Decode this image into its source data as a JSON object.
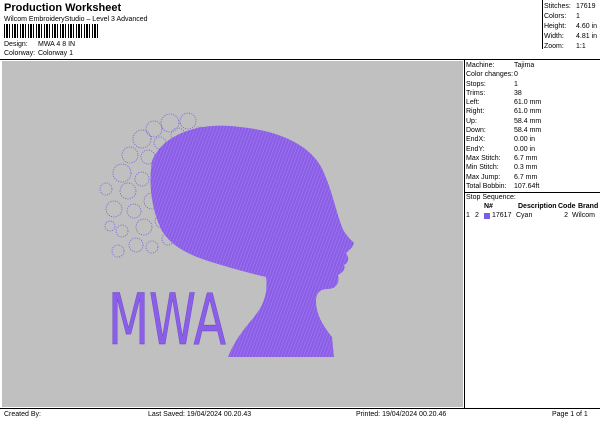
{
  "header": {
    "title": "Production Worksheet",
    "subtitle": "Wilcom EmbroideryStudio – Level 3 Advanced",
    "design_label": "Design:",
    "design_value": "MWA 4 8 IN",
    "colorway_label": "Colorway:",
    "colorway_value": "Colorway 1"
  },
  "summary": [
    {
      "k": "Stitches:",
      "v": "17619"
    },
    {
      "k": "Colors:",
      "v": "1"
    },
    {
      "k": "Height:",
      "v": "4.60 in"
    },
    {
      "k": "Width:",
      "v": "4.81 in"
    },
    {
      "k": "Zoom:",
      "v": "1:1"
    }
  ],
  "machine_info": [
    {
      "k": "Machine:",
      "v": "Tajima"
    },
    {
      "k": "Color changes:",
      "v": "0"
    },
    {
      "k": "Stops:",
      "v": "1"
    },
    {
      "k": "Trims:",
      "v": "38"
    },
    {
      "k": "Left:",
      "v": "61.0 mm"
    },
    {
      "k": "Right:",
      "v": "61.0 mm"
    },
    {
      "k": "Up:",
      "v": "58.4 mm"
    },
    {
      "k": "Down:",
      "v": "58.4 mm"
    },
    {
      "k": "EndX:",
      "v": "0.00 in"
    },
    {
      "k": "EndY:",
      "v": "0.00 in"
    },
    {
      "k": "Max Stitch:",
      "v": "6.7 mm"
    },
    {
      "k": "Min Stitch:",
      "v": "0.3 mm"
    },
    {
      "k": "Max Jump:",
      "v": "6.7 mm"
    },
    {
      "k": "Total Bobbin:",
      "v": "107.64ft"
    }
  ],
  "stop_sequence": {
    "title": "Stop Sequence:",
    "headers": [
      "N#",
      "Description",
      "Code",
      "Brand"
    ],
    "rows": [
      {
        "stop": "1",
        "n": "2",
        "stitches": "17617",
        "description": "Cyan",
        "code": "2",
        "brand": "Wilcom",
        "color": "#7b5fe0"
      }
    ]
  },
  "design": {
    "text": "MWA",
    "thread_color": "#8a5ee6"
  },
  "footer": {
    "created_by": "Created By:",
    "last_saved": "Last Saved: 19/04/2024 00.20.43",
    "printed": "Printed: 19/04/2024 00.20.46",
    "page": "Page 1 of 1"
  }
}
